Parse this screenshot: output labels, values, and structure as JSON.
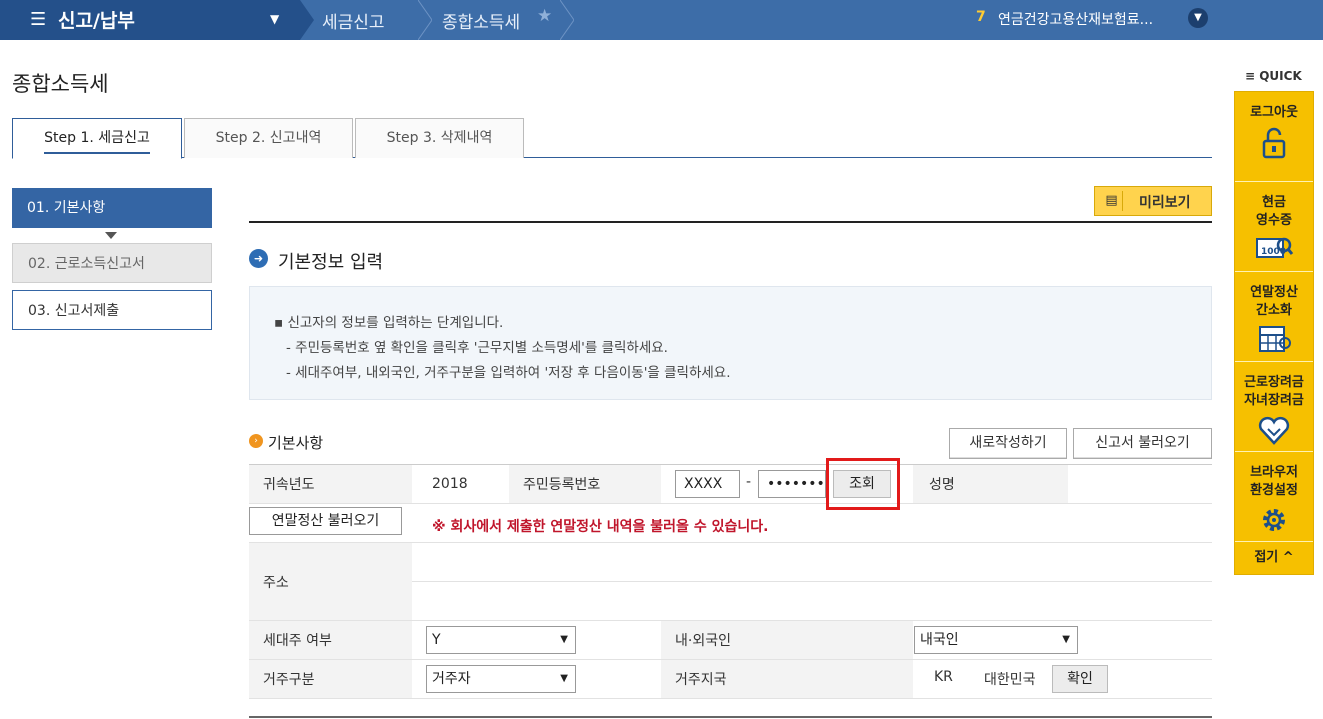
{
  "topnav": {
    "menu_title": "신고/납부",
    "crumb1": "세금신고",
    "crumb2": "종합소득세",
    "notice_num": "7",
    "notice_text": "연금건강고용산재보험료..."
  },
  "page_title": "종합소득세",
  "tabs": [
    {
      "label": "Step 1. 세금신고"
    },
    {
      "label": "Step 2. 신고내역"
    },
    {
      "label": "Step 3. 삭제내역"
    }
  ],
  "side_menu": [
    {
      "label": "01. 기본사항"
    },
    {
      "label": "02. 근로소득신고서"
    },
    {
      "label": "03. 신고서제출"
    }
  ],
  "preview_label": "미리보기",
  "section_title": "기본정보 입력",
  "info_lines": [
    "▪ 신고자의 정보를 입력하는 단계입니다.",
    "- 주민등록번호 옆 확인을 클릭후 '근무지별 소득명세'를 클릭하세요.",
    "- 세대주여부, 내외국인, 거주구분을 입력하여 '저장 후 다음이동'을 클릭하세요."
  ],
  "basic": {
    "title": "기본사항",
    "new_btn": "새로작성하기",
    "load_btn": "신고서 불러오기",
    "year_label": "귀속년도",
    "year_value": "2018",
    "rrn_label": "주민등록번호",
    "rrn_front": "XXXX",
    "rrn_dash": "-",
    "rrn_back": "•••••••",
    "lookup_btn": "조회",
    "name_label": "성명",
    "yearend_btn": "연말정산 불러오기",
    "yearend_notice": "※ 회사에서 제출한 연말정산 내역을 불러올 수 있습니다.",
    "address_label": "주소",
    "householder_label": "세대주 여부",
    "householder_value": "Y",
    "nationality_label": "내·외국인",
    "nationality_value": "내국인",
    "residency_label": "거주구분",
    "residency_value": "거주자",
    "country_label": "거주지국",
    "country_code": "KR",
    "country_name": "대한민국",
    "confirm_btn": "확인"
  },
  "quick": {
    "title": "≡ QUICK",
    "items": [
      {
        "label": "로그아웃"
      },
      {
        "label1": "현금",
        "label2": "영수증"
      },
      {
        "label1": "연말정산",
        "label2": "간소화"
      },
      {
        "label1": "근로장려금",
        "label2": "자녀장려금"
      },
      {
        "label1": "브라우저",
        "label2": "환경설정"
      }
    ],
    "close": "접기 ^"
  }
}
